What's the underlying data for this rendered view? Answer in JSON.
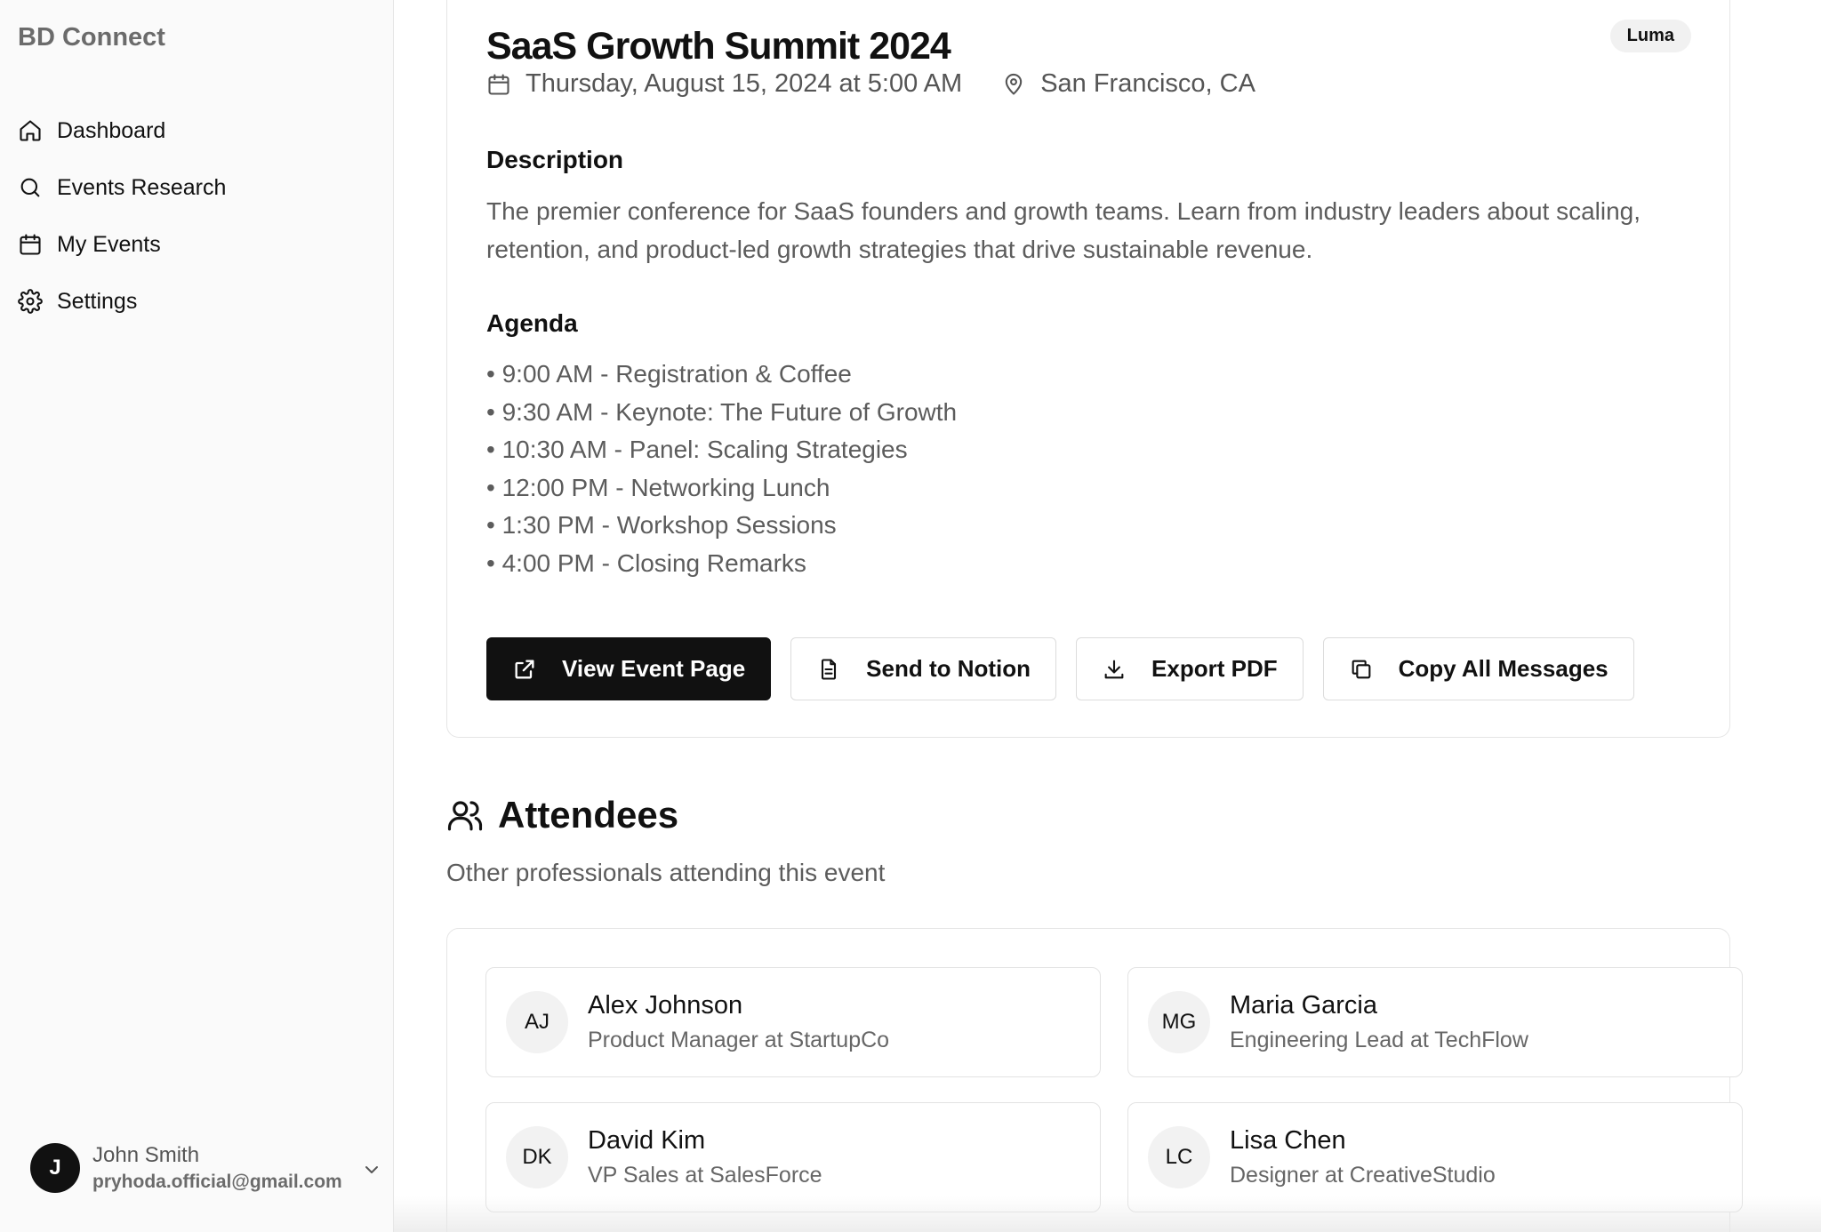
{
  "sidebar": {
    "brand": "BD Connect",
    "items": [
      {
        "label": "Dashboard",
        "icon": "home-icon"
      },
      {
        "label": "Events Research",
        "icon": "search-icon"
      },
      {
        "label": "My Events",
        "icon": "calendar-icon"
      },
      {
        "label": "Settings",
        "icon": "gear-icon"
      }
    ],
    "user": {
      "initial": "J",
      "name": "John Smith",
      "email": "pryhoda.official@gmail.com"
    }
  },
  "event": {
    "title": "SaaS Growth Summit 2024",
    "source_badge": "Luma",
    "date": "Thursday, August 15, 2024 at 5:00 AM",
    "location": "San Francisco, CA",
    "description_heading": "Description",
    "description": "The premier conference for SaaS founders and growth teams. Learn from industry leaders about scaling, retention, and product-led growth strategies that drive sustainable revenue.",
    "agenda_heading": "Agenda",
    "agenda": [
      "9:00 AM - Registration & Coffee",
      "9:30 AM - Keynote: The Future of Growth",
      "10:30 AM - Panel: Scaling Strategies",
      "12:00 PM - Networking Lunch",
      "1:30 PM - Workshop Sessions",
      "4:00 PM - Closing Remarks"
    ],
    "actions": {
      "view_event": "View Event Page",
      "send_notion": "Send to Notion",
      "export_pdf": "Export PDF",
      "copy_messages": "Copy All Messages"
    }
  },
  "attendees": {
    "title": "Attendees",
    "subtitle": "Other professionals attending this event",
    "list": [
      {
        "initials": "AJ",
        "name": "Alex Johnson",
        "role": "Product Manager at StartupCo"
      },
      {
        "initials": "MG",
        "name": "Maria Garcia",
        "role": "Engineering Lead at TechFlow"
      },
      {
        "initials": "DK",
        "name": "David Kim",
        "role": "VP Sales at SalesForce"
      },
      {
        "initials": "LC",
        "name": "Lisa Chen",
        "role": "Designer at CreativeStudio"
      }
    ]
  },
  "colors": {
    "primary": "#111111",
    "muted_text": "#5c5c5c",
    "sidebar_bg": "#fafafa",
    "border": "#e5e5e5"
  }
}
